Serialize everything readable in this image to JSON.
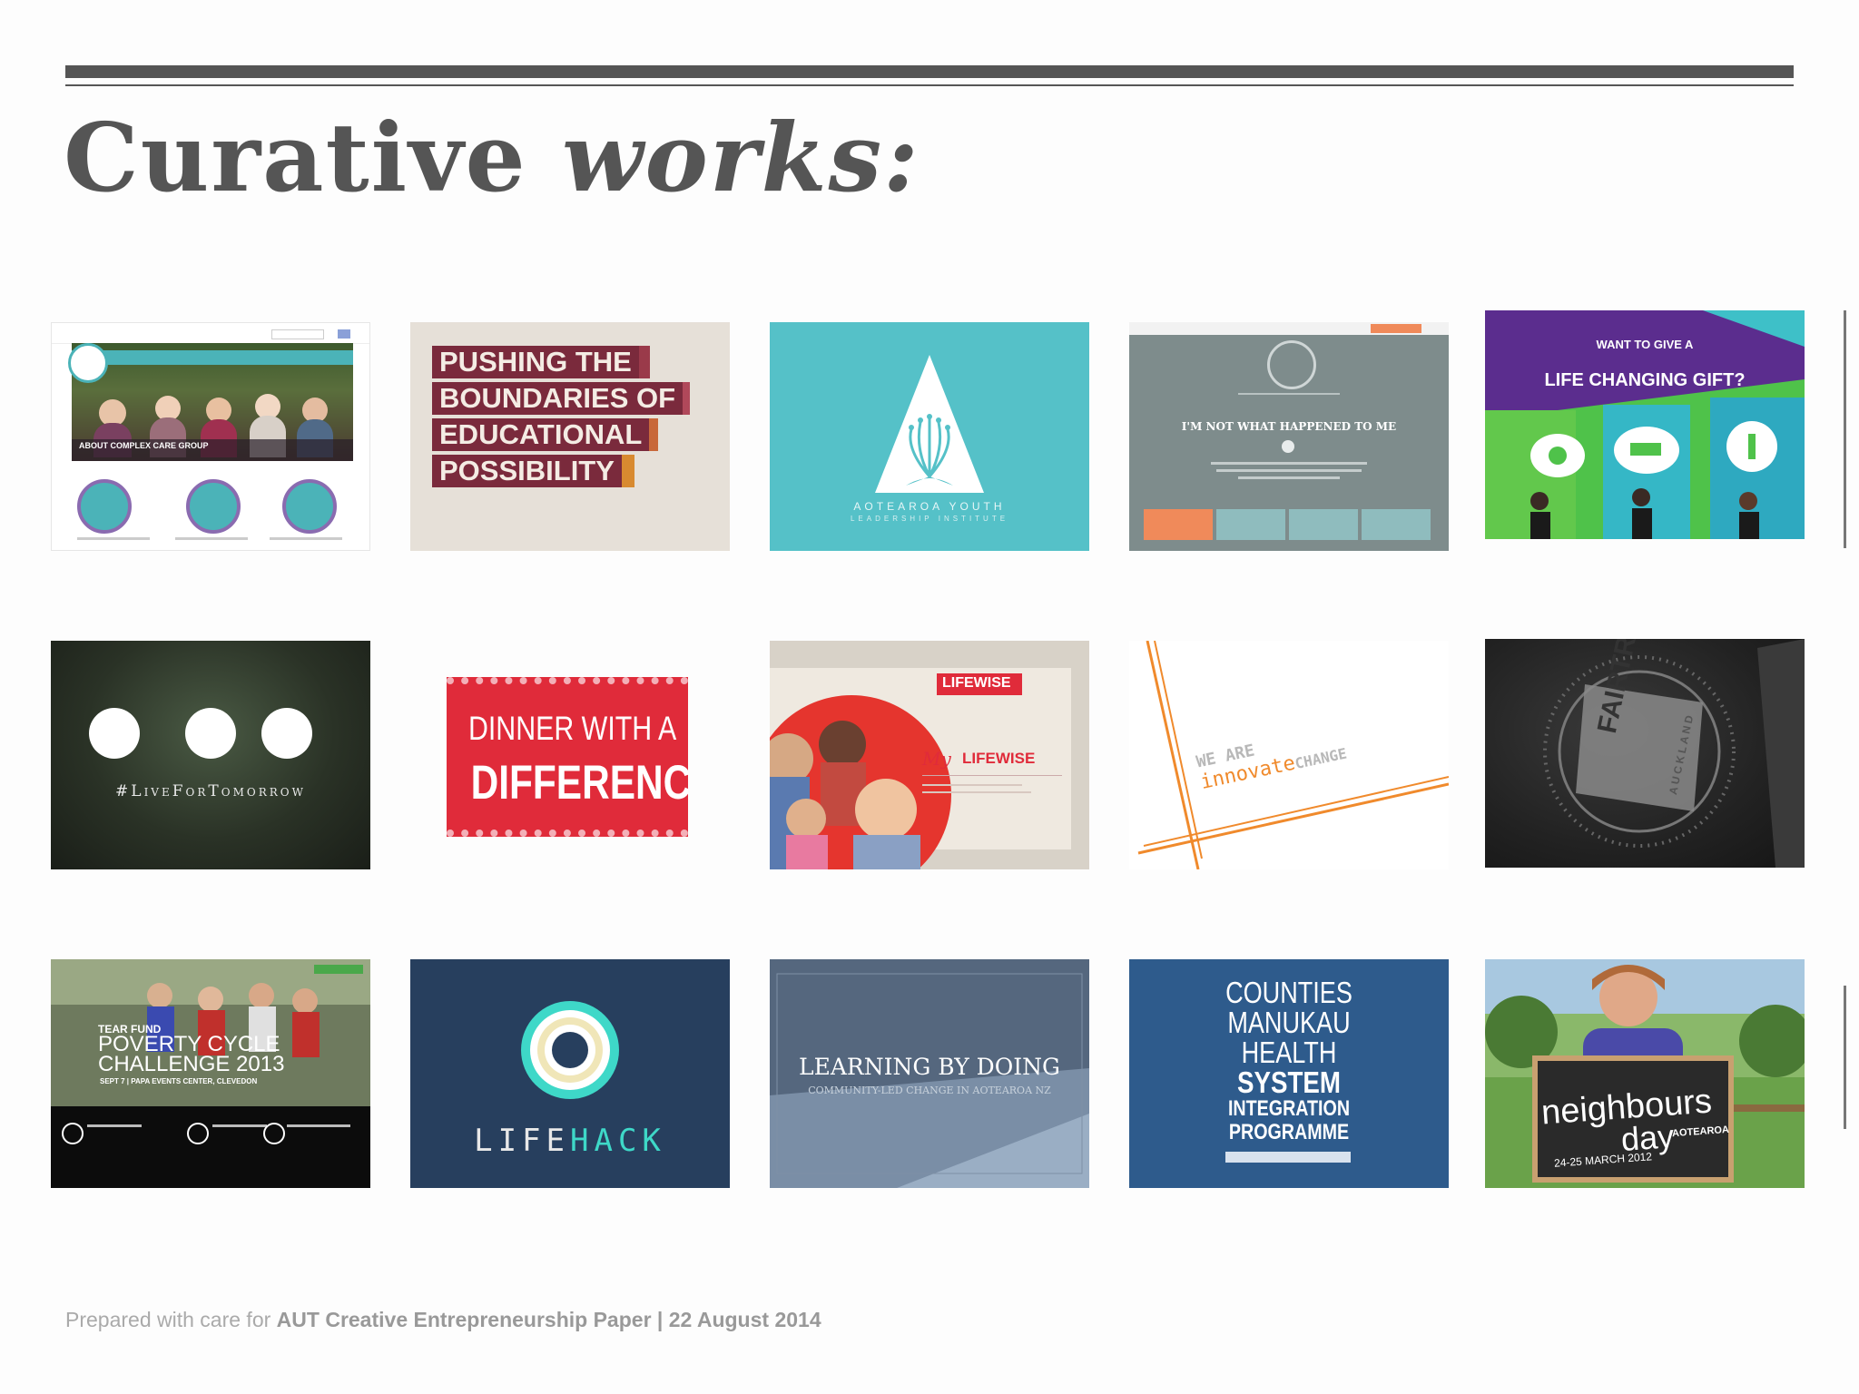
{
  "title": {
    "regular": "Curative",
    "italic": "works:"
  },
  "footer": {
    "prefix": "Prepared with care for",
    "bold": "AUT Creative Entrepreneurship Paper | 22 August 2014"
  },
  "tiles": {
    "complex_care": {
      "heading": "ABOUT COMPLEX CARE GROUP"
    },
    "pushing": {
      "lines": [
        "PUSHING THE",
        "BOUNDARIES OF",
        "EDUCATIONAL",
        "POSSIBILITY"
      ]
    },
    "aotearoa": {
      "line1": "AOTEAROA YOUTH",
      "line2": "LEADERSHIP INSTITUTE"
    },
    "harbour": {
      "heading": "I'M NOT WHAT HAPPENED TO ME"
    },
    "gift": {
      "line1": "WANT TO GIVE A",
      "line2": "LIFE CHANGING GIFT?"
    },
    "livefortomorrow": {
      "tag": "#LiveForTomorrow"
    },
    "dinner": {
      "line1": "DINNER WITH A",
      "line2": "DIFFERENCE"
    },
    "lifewise": {
      "badge": "LIFEWISE",
      "my": "My",
      "name": "LIFEWISE"
    },
    "innovate": {
      "we_are": "WE ARE",
      "innovate": "innovate",
      "change": "CHANGE"
    },
    "fairtrade": {
      "line1": "FAIRTRADE",
      "line2": "AUCKLAND"
    },
    "poverty": {
      "line1": "TEAR FUND",
      "line2": "POVERTY CYCLE",
      "line3": "CHALLENGE 2013",
      "sub": "SEPT 7 | PAPA EVENTS CENTER, CLEVEDON"
    },
    "lifehack": {
      "life": "LIFE",
      "hack": "HACK"
    },
    "learning": {
      "title": "LEARNING BY DOING",
      "sub": "COMMUNITY-LED CHANGE IN AOTEAROA NZ"
    },
    "counties": {
      "lines": [
        "COUNTIES",
        "MANUKAU",
        "HEALTH"
      ],
      "bold_lines": [
        "SYSTEM",
        "INTEGRATION",
        "PROGRAMME"
      ]
    },
    "neighbours": {
      "line1": "neighbours",
      "line2": "day",
      "place": "AOTEAROA",
      "date": "24-25 MARCH 2012"
    }
  },
  "colors": {
    "teal": "#55c1c8",
    "purple": "#5b2d8e",
    "red": "#e02b3a",
    "navy": "#273f5e",
    "blue": "#2e5b8c",
    "orange": "#f08a2c"
  }
}
